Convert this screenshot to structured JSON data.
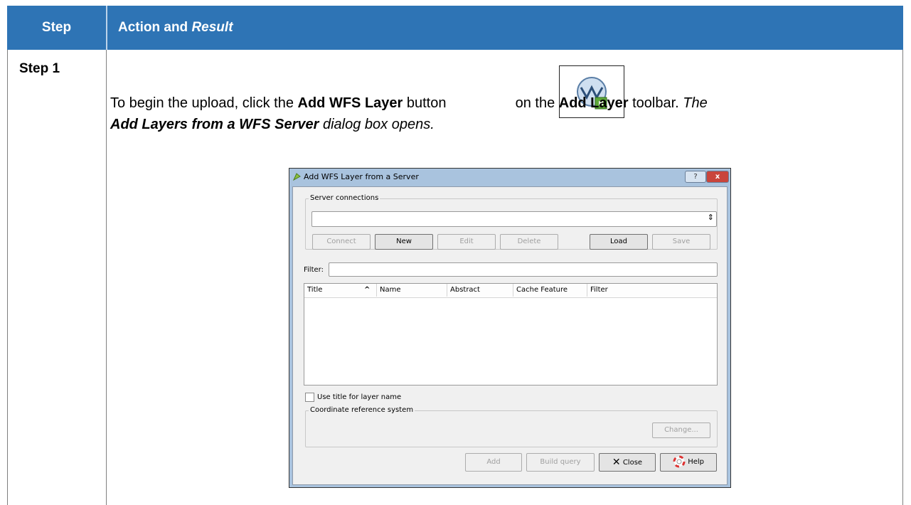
{
  "table": {
    "header_step": "Step",
    "header_action": "Action and",
    "header_result": "Result",
    "step_label": "Step 1"
  },
  "instruction": {
    "part1": "To begin the upload, click the ",
    "bold1": "Add WFS Layer",
    "part2": " button ",
    "part3": " on the ",
    "bold2": "Add Layer",
    "part4": " toolbar. ",
    "italic1": "The ",
    "bold_italic": "Add Layers from a WFS Server",
    "italic2": " dialog box opens."
  },
  "dialog": {
    "title": "Add WFS Layer from a Server",
    "help_button": "?",
    "close_button": "x",
    "server_connections": "Server connections",
    "connection_value": "",
    "buttons": {
      "connect": "Connect",
      "new": "New",
      "edit": "Edit",
      "delete": "Delete",
      "load": "Load",
      "save": "Save"
    },
    "filter_label": "Filter:",
    "filter_value": "",
    "columns": [
      "Title",
      "Name",
      "Abstract",
      "Cache Feature",
      "Filter"
    ],
    "sort_indicator": "^",
    "use_title_checkbox": "Use title for layer name",
    "crs_group": "Coordinate reference system",
    "change_button": "Change...",
    "bottom_buttons": {
      "add": "Add",
      "build_query": "Build query",
      "close": "Close",
      "help": "Help"
    }
  },
  "colors": {
    "header_bg": "#2e74b5",
    "dialog_frame": "#a9c3de"
  },
  "icons": [
    "wfs-layer-icon",
    "qgis-icon",
    "close-x-icon",
    "help-lifebuoy-icon",
    "combo-arrow-icon",
    "sort-up-icon"
  ]
}
